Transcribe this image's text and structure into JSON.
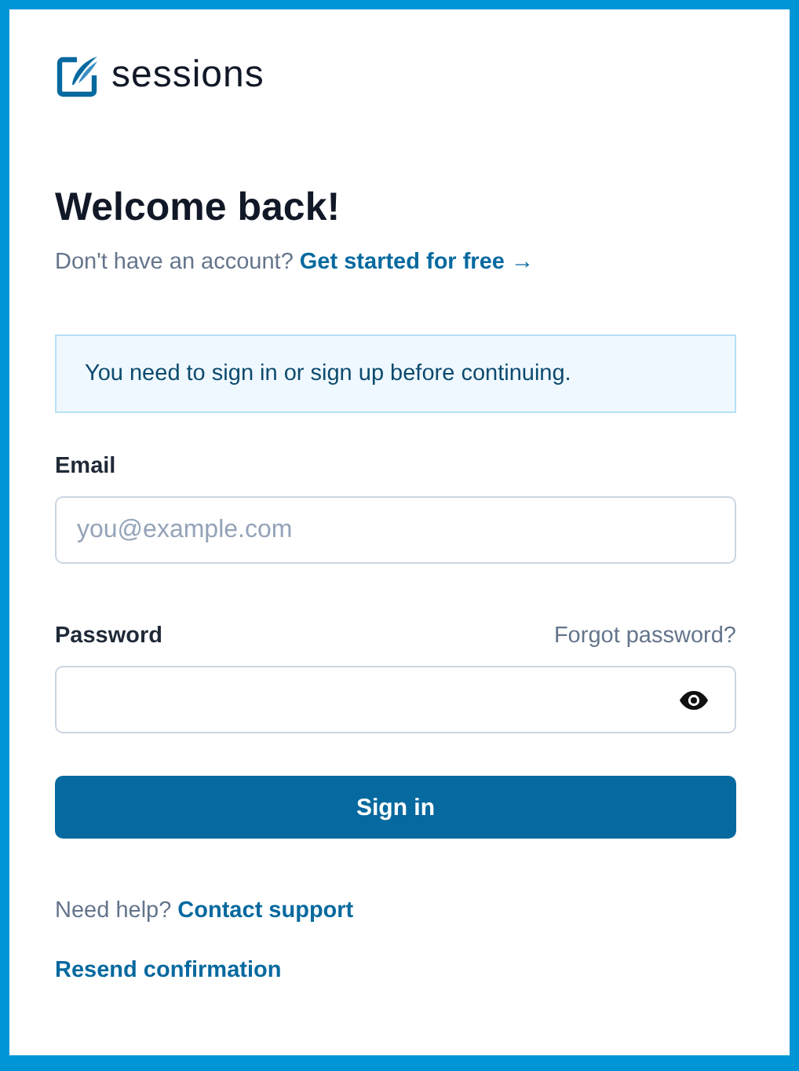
{
  "logo": {
    "name": "sessions"
  },
  "heading": "Welcome back!",
  "signup": {
    "prompt": "Don't have an account?",
    "link": "Get started for free →"
  },
  "alert": "You need to sign in or sign up before continuing.",
  "email": {
    "label": "Email",
    "placeholder": "you@example.com"
  },
  "password": {
    "label": "Password",
    "forgot": "Forgot password?"
  },
  "submit": "Sign in",
  "help": {
    "prompt": "Need help?",
    "link": "Contact support"
  },
  "resend": "Resend confirmation"
}
